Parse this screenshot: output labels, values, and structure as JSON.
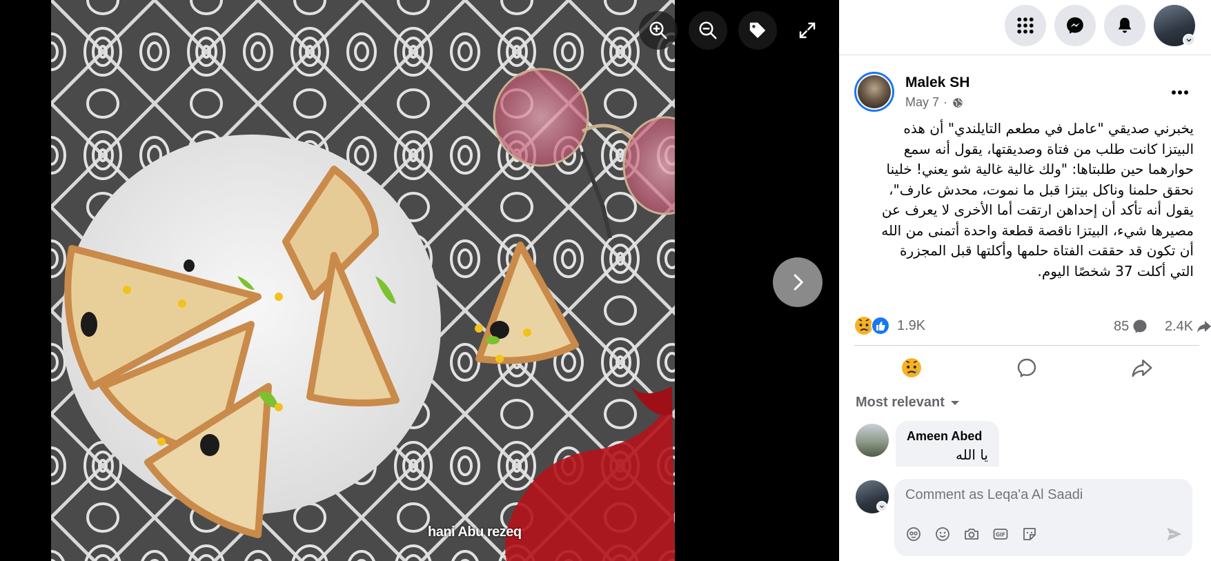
{
  "viewer": {
    "watermark": "hani Abu rezeq",
    "zoom_in_icon": "zoom-in-icon",
    "zoom_out_icon": "zoom-out-icon",
    "tag_icon": "tag-icon",
    "fullscreen_icon": "fullscreen-icon",
    "next_icon": "chevron-right-icon"
  },
  "topbar": {
    "menu_icon": "grid-menu-icon",
    "messenger_icon": "messenger-icon",
    "notifications_icon": "bell-icon"
  },
  "post": {
    "author": "Malek SH",
    "date": "May 7",
    "separator": "·",
    "privacy_icon": "globe-icon",
    "text": "يخبرني صديقي \"عامل في مطعم التايلندي\" أن هذه\nالبيتزا كانت طلب من فتاة وصديقتها، يقول أنه سمع\nحوارهما حين طلبتاها: \"ولك غالية غالية شو يعني! خلينا\nنحقق حلمنا وناكل بيتزا قبل ما نموت، محدش عارف\"،\nيقول أنه تأكد أن إحداهن ارتقت أما الأخرى لا يعرف عن\nمصيرها شيء، البيتزا ناقصة قطعة واحدة أتمنى من الله\nأن تكون قد حققت الفتاة حلمها وأكلتها قبل المجزرة\nالتي أكلت 37 شخصًا اليوم.",
    "reaction_count": "1.9K",
    "comment_count": "85",
    "share_count": "2.4K"
  },
  "comments": {
    "sort_label": "Most relevant",
    "items": [
      {
        "name": "Ameen Abed",
        "text": "يا الله"
      }
    ]
  },
  "composer": {
    "placeholder": "Comment as Leqa'a Al Saadi"
  },
  "colors": {
    "accent": "#1877f2",
    "secondary_text": "#65676b",
    "button_bg": "#e4e6eb"
  }
}
